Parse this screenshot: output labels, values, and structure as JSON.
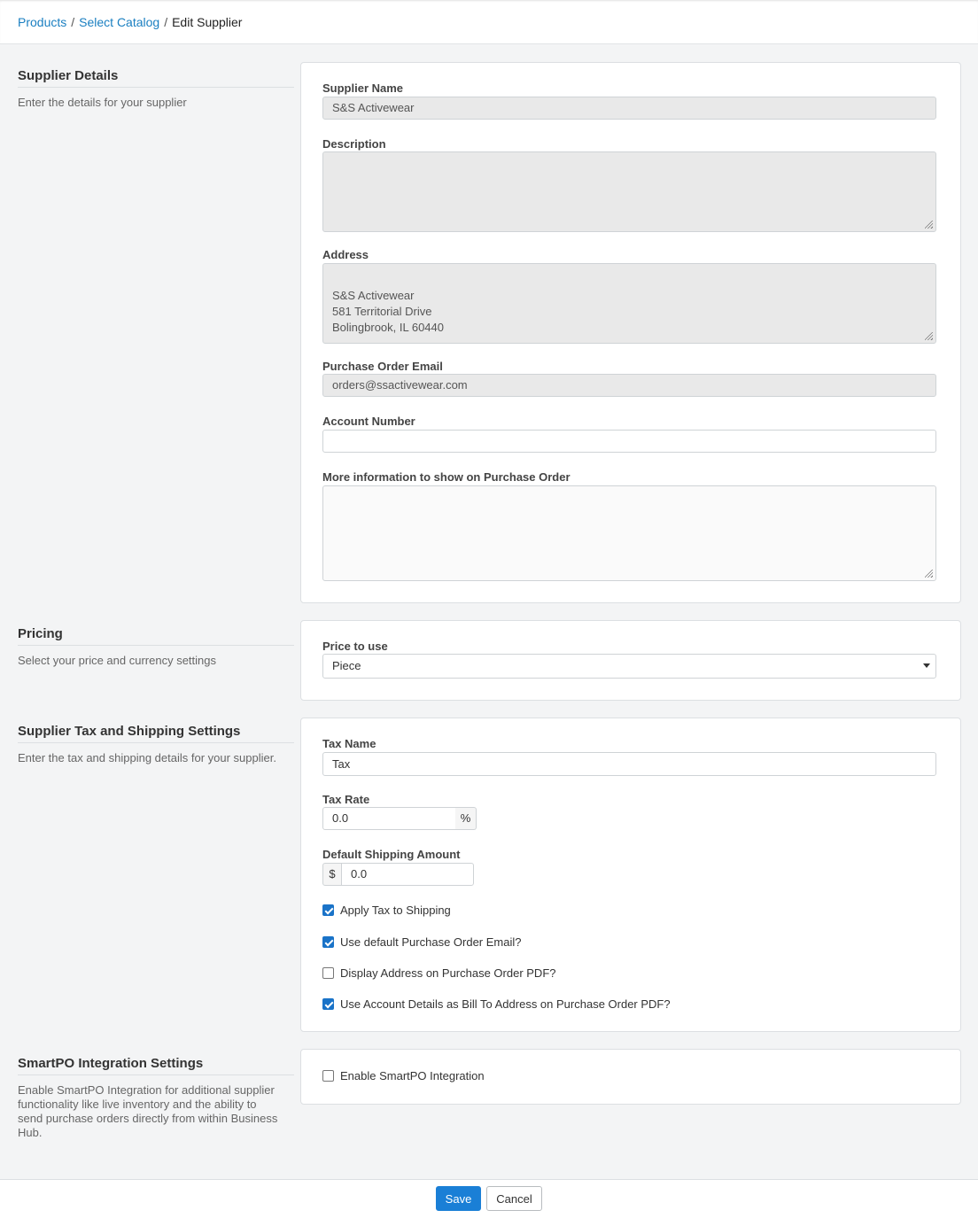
{
  "breadcrumb": {
    "items": [
      "Products",
      "Select Catalog"
    ],
    "current": "Edit Supplier"
  },
  "sections": {
    "supplier_details": {
      "title": "Supplier Details",
      "description": "Enter the details for your supplier"
    },
    "pricing": {
      "title": "Pricing",
      "description": "Select your price and currency settings"
    },
    "tax_shipping": {
      "title": "Supplier Tax and Shipping Settings",
      "description": "Enter the tax and shipping details for your supplier."
    },
    "smartpo": {
      "title": "SmartPO Integration Settings",
      "description": "Enable SmartPO Integration for additional supplier functionality like live inventory and the ability to send purchase orders directly from within Business Hub."
    }
  },
  "form": {
    "supplier_name": {
      "label": "Supplier Name",
      "value": "S&S Activewear"
    },
    "description": {
      "label": "Description",
      "value": ""
    },
    "address": {
      "label": "Address",
      "value": "S&S Activewear\n581 Territorial Drive\nBolingbrook, IL 60440"
    },
    "po_email": {
      "label": "Purchase Order Email",
      "value": "orders@ssactivewear.com"
    },
    "account_number": {
      "label": "Account Number",
      "value": ""
    },
    "more_info": {
      "label": "More information to show on Purchase Order",
      "value": ""
    },
    "price_to_use": {
      "label": "Price to use",
      "value": "Piece"
    },
    "tax_name": {
      "label": "Tax Name",
      "value": "Tax"
    },
    "tax_rate": {
      "label": "Tax Rate",
      "value": "0.0",
      "suffix": "%"
    },
    "shipping": {
      "label": "Default Shipping Amount",
      "value": "0.0",
      "prefix": "$"
    }
  },
  "checkboxes": {
    "apply_tax_shipping": {
      "label": "Apply Tax to Shipping",
      "checked": true
    },
    "default_po_email": {
      "label": "Use default Purchase Order Email?",
      "checked": true
    },
    "display_address": {
      "label": "Display Address on Purchase Order PDF?",
      "checked": false
    },
    "account_bill_to": {
      "label": "Use Account Details as Bill To Address on Purchase Order PDF?",
      "checked": true
    },
    "smartpo": {
      "label": "Enable SmartPO Integration",
      "checked": false
    }
  },
  "footer": {
    "save_label": "Save",
    "cancel_label": "Cancel"
  }
}
